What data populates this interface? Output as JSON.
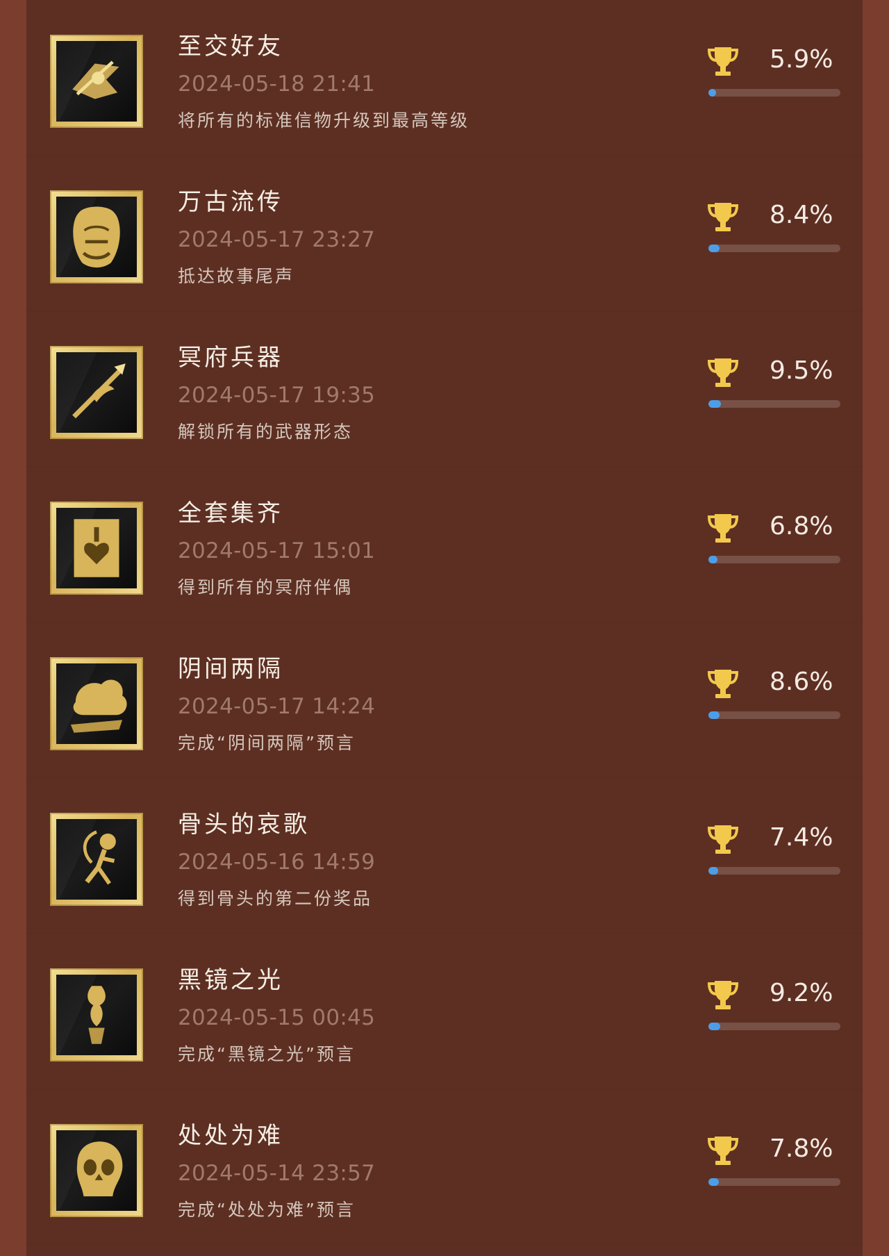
{
  "achievements": [
    {
      "title": "至交好友",
      "time": "2024-05-18 21:41",
      "desc": "将所有的标准信物升级到最高等级",
      "percent": "5.9%",
      "progress": 0.059,
      "icon": "raven-icon"
    },
    {
      "title": "万古流传",
      "time": "2024-05-17 23:27",
      "desc": "抵达故事尾声",
      "percent": "8.4%",
      "progress": 0.084,
      "icon": "face-icon"
    },
    {
      "title": "冥府兵器",
      "time": "2024-05-17 19:35",
      "desc": "解锁所有的武器形态",
      "percent": "9.5%",
      "progress": 0.095,
      "icon": "spear-icon"
    },
    {
      "title": "全套集齐",
      "time": "2024-05-17 15:01",
      "desc": "得到所有的冥府伴偶",
      "percent": "6.8%",
      "progress": 0.068,
      "icon": "heart-lock-icon"
    },
    {
      "title": "阴间两隔",
      "time": "2024-05-17 14:24",
      "desc": "完成“阴间两隔”预言",
      "percent": "8.6%",
      "progress": 0.086,
      "icon": "cloud-figure-icon"
    },
    {
      "title": "骨头的哀歌",
      "time": "2024-05-16 14:59",
      "desc": "得到骨头的第二份奖品",
      "percent": "7.4%",
      "progress": 0.074,
      "icon": "skeleton-icon"
    },
    {
      "title": "黑镜之光",
      "time": "2024-05-15 00:45",
      "desc": "完成“黑镜之光”预言",
      "percent": "9.2%",
      "progress": 0.092,
      "icon": "candle-icon"
    },
    {
      "title": "处处为难",
      "time": "2024-05-14 23:57",
      "desc": "完成“处处为难”预言",
      "percent": "7.8%",
      "progress": 0.078,
      "icon": "skull-icon"
    }
  ],
  "colors": {
    "background": "#5d2f22",
    "outer": "#7a3d2e",
    "accent": "#4d9ee9",
    "gold": "#f2c94c"
  }
}
